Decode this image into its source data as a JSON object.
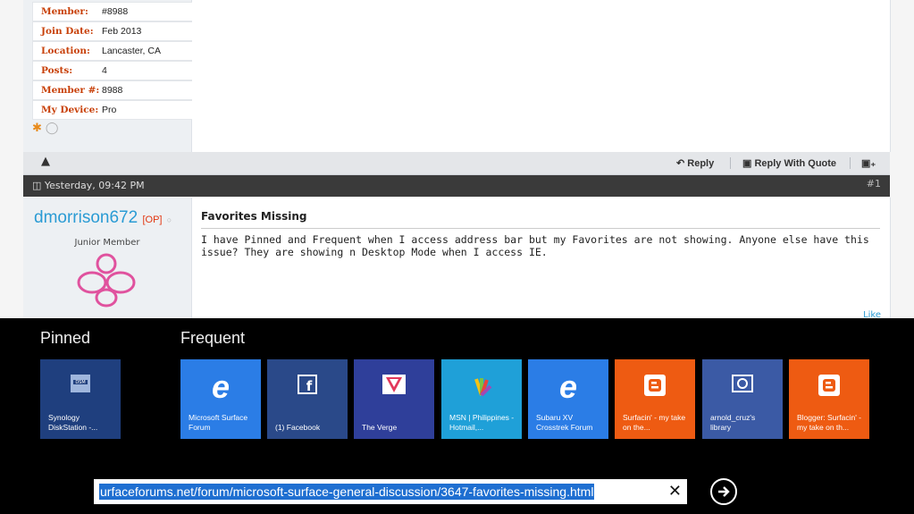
{
  "profile_rows": [
    {
      "label": "Member:",
      "value": "#8988"
    },
    {
      "label": "Join Date:",
      "value": "Feb 2013"
    },
    {
      "label": "Location:",
      "value": "Lancaster, CA"
    },
    {
      "label": "Posts:",
      "value": "4"
    },
    {
      "label": "Member #:",
      "value": "8988"
    },
    {
      "label": "My Device:",
      "value": "Pro"
    }
  ],
  "actions": {
    "reply": "Reply",
    "reply_quote": "Reply With Quote"
  },
  "post": {
    "timestamp": "Yesterday, 09:42 PM",
    "number": "#1",
    "username": "dmorrison672",
    "op_tag": "[OP]",
    "role": "Junior Member",
    "title": "Favorites Missing",
    "body": "I have Pinned and Frequent when I access address bar but my Favorites are not showing. Anyone else have this issue? They are showing n Desktop Mode when I access IE.",
    "like": "Like"
  },
  "pinned_header": "Pinned",
  "frequent_header": "Frequent",
  "tiles": [
    {
      "label": "Synology DiskStation -...",
      "color": "#1f3f7e",
      "icon": "dsm-icon"
    },
    {
      "label": "Microsoft Surface Forum",
      "color": "#2b7de6",
      "icon": "ie-icon"
    },
    {
      "label": "(1) Facebook",
      "color": "#2a4989",
      "icon": "facebook-icon"
    },
    {
      "label": "The Verge",
      "color": "#2f3f9a",
      "icon": "verge-icon"
    },
    {
      "label": "MSN | Philippines - Hotmail,...",
      "color": "#1fa0d8",
      "icon": "msn-icon"
    },
    {
      "label": "Subaru XV Crosstrek Forum",
      "color": "#2b7de6",
      "icon": "ie-icon"
    },
    {
      "label": "Surfacin' - my take on the...",
      "color": "#ee5b12",
      "icon": "blogger-icon"
    },
    {
      "label": "arnold_cruz's library",
      "color": "#3b5aa5",
      "icon": "camera-icon"
    },
    {
      "label": "Blogger: Surfacin' - my take on th...",
      "color": "#ee5b12",
      "icon": "blogger-icon"
    }
  ],
  "address": {
    "url": "urfaceforums.net/forum/microsoft-surface-general-discussion/3647-favorites-missing.html"
  },
  "colors": {
    "accent": "#2a9bd4",
    "label_red": "#c8410a",
    "selection": "#1f6fd1"
  }
}
